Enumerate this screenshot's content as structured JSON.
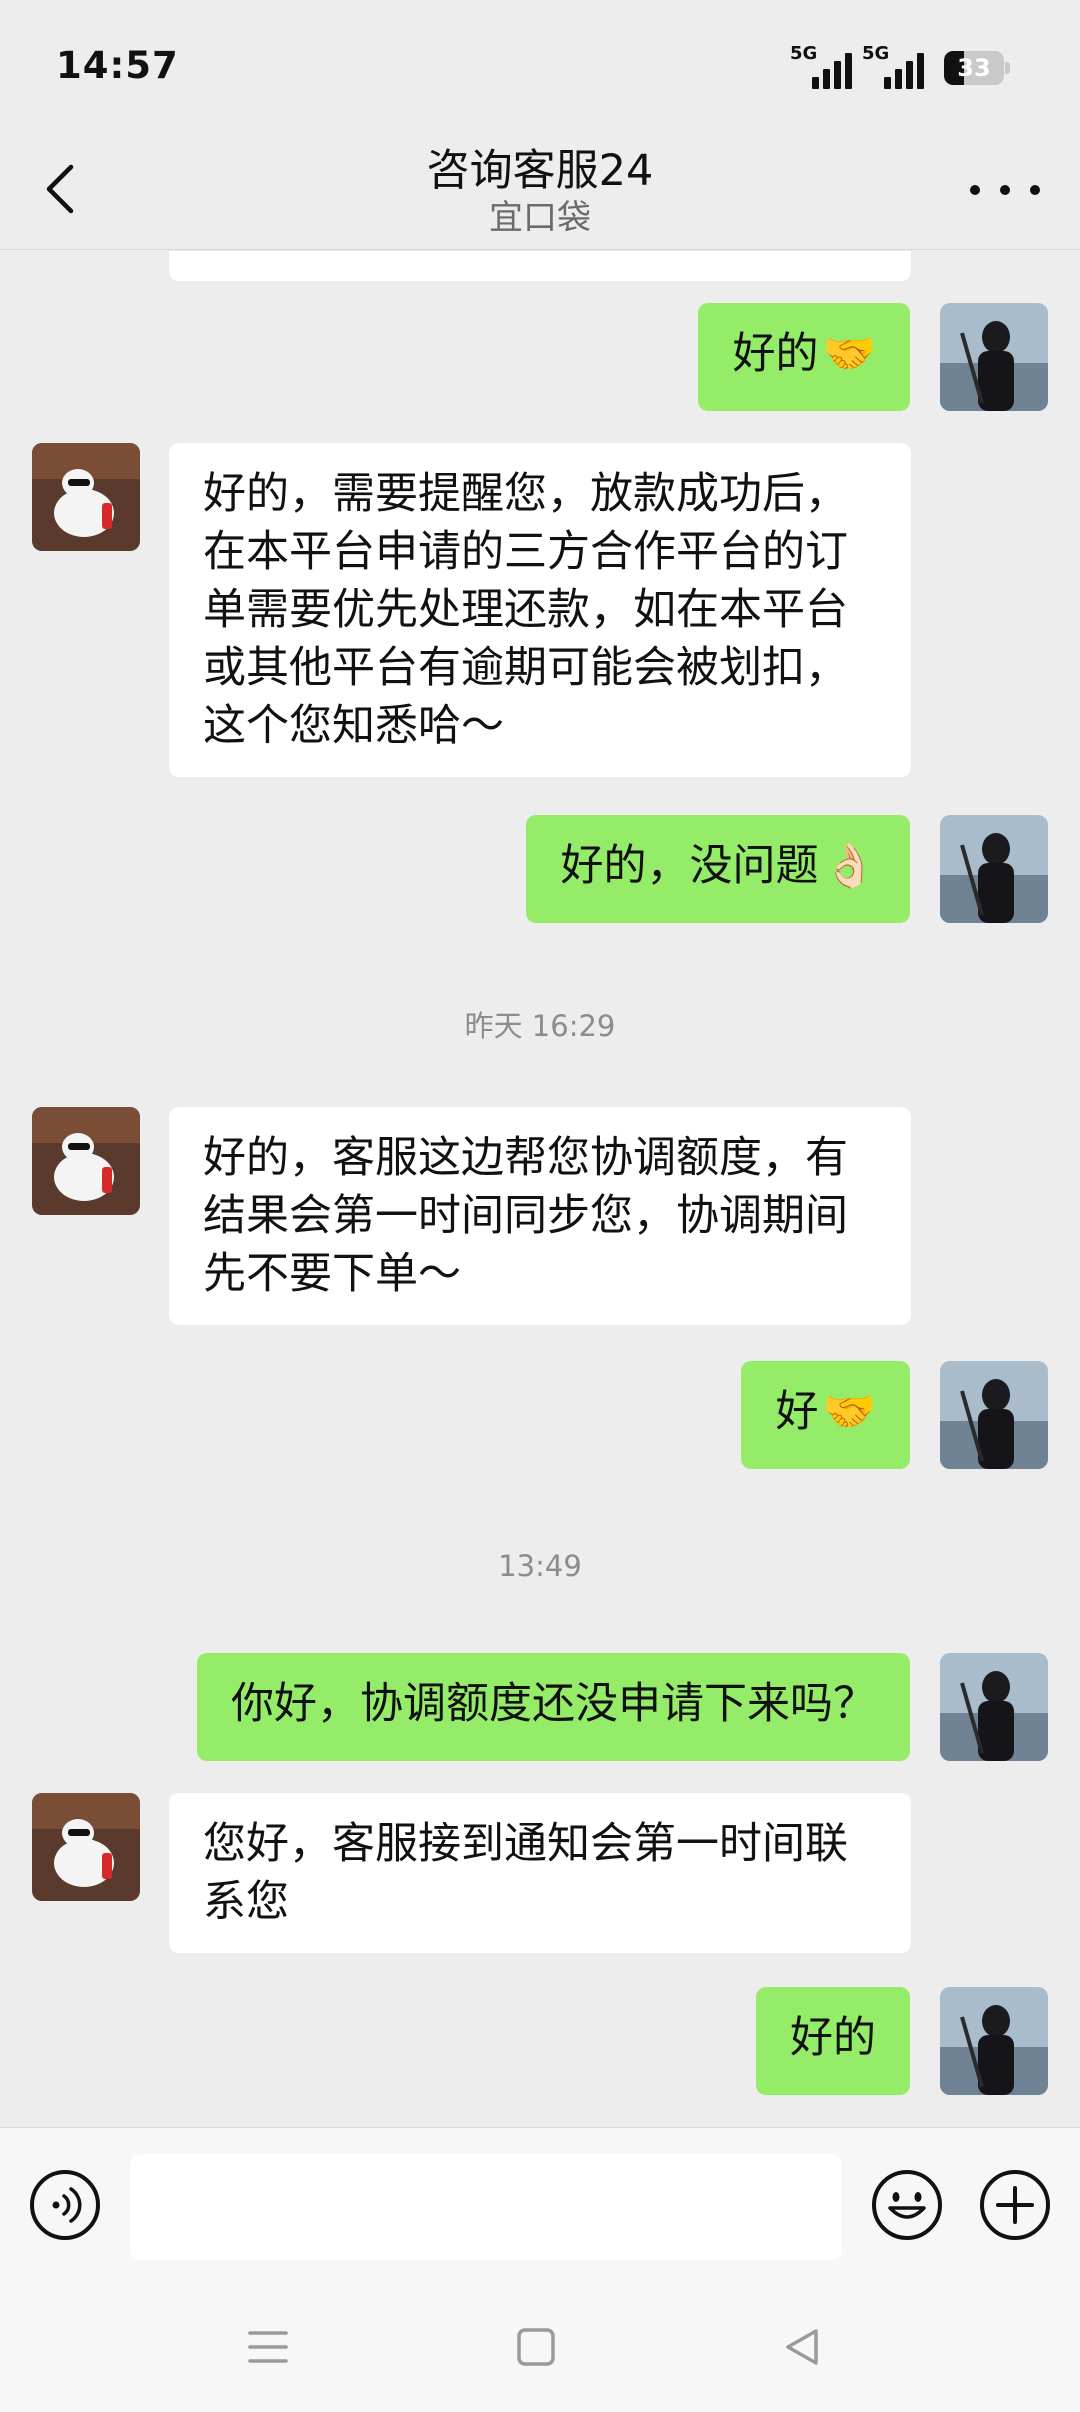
{
  "status_bar": {
    "time": "14:57",
    "sim1_label": "5G",
    "sim2_label": "5G",
    "battery_level": "33",
    "battery_fraction": 0.33
  },
  "header": {
    "back_icon": "chevron-left-icon",
    "title": "咨询客服24",
    "subtitle": "宜口袋",
    "more_icon": "more-dots-icon"
  },
  "messages": [
    {
      "from": "me",
      "text": "好的",
      "emoji": "🤝"
    },
    {
      "from": "agent",
      "text": "好的，需要提醒您，放款成功后，在本平台申请的三方合作平台的订单需要优先处理还款，如在本平台或其他平台有逾期可能会被划扣，这个您知悉哈～"
    },
    {
      "from": "me",
      "text": "好的，没问题",
      "emoji": "👌🏻"
    },
    {
      "from": "agent",
      "text": "好的，客服这边帮您协调额度，有结果会第一时间同步您，协调期间先不要下单～"
    },
    {
      "from": "me",
      "text": "好",
      "emoji": "🤝"
    },
    {
      "from": "me",
      "text": "你好，协调额度还没申请下来吗？"
    },
    {
      "from": "agent",
      "text": "您好，客服接到通知会第一时间联系您"
    },
    {
      "from": "me",
      "text": "好的"
    }
  ],
  "timestamps": [
    "昨天 16:29",
    "13:49"
  ],
  "input_bar": {
    "voice_icon": "voice-icon",
    "emoji_icon": "emoji-icon",
    "plus_icon": "plus-icon",
    "placeholder": ""
  },
  "nav_bar": {
    "menu_icon": "menu-icon",
    "home_icon": "home-icon",
    "back_icon": "back-triangle-icon"
  },
  "colors": {
    "background": "#ededed",
    "bubble_me": "#95ec69",
    "bubble_agent": "#ffffff",
    "timestamp": "#8c8c8c"
  }
}
